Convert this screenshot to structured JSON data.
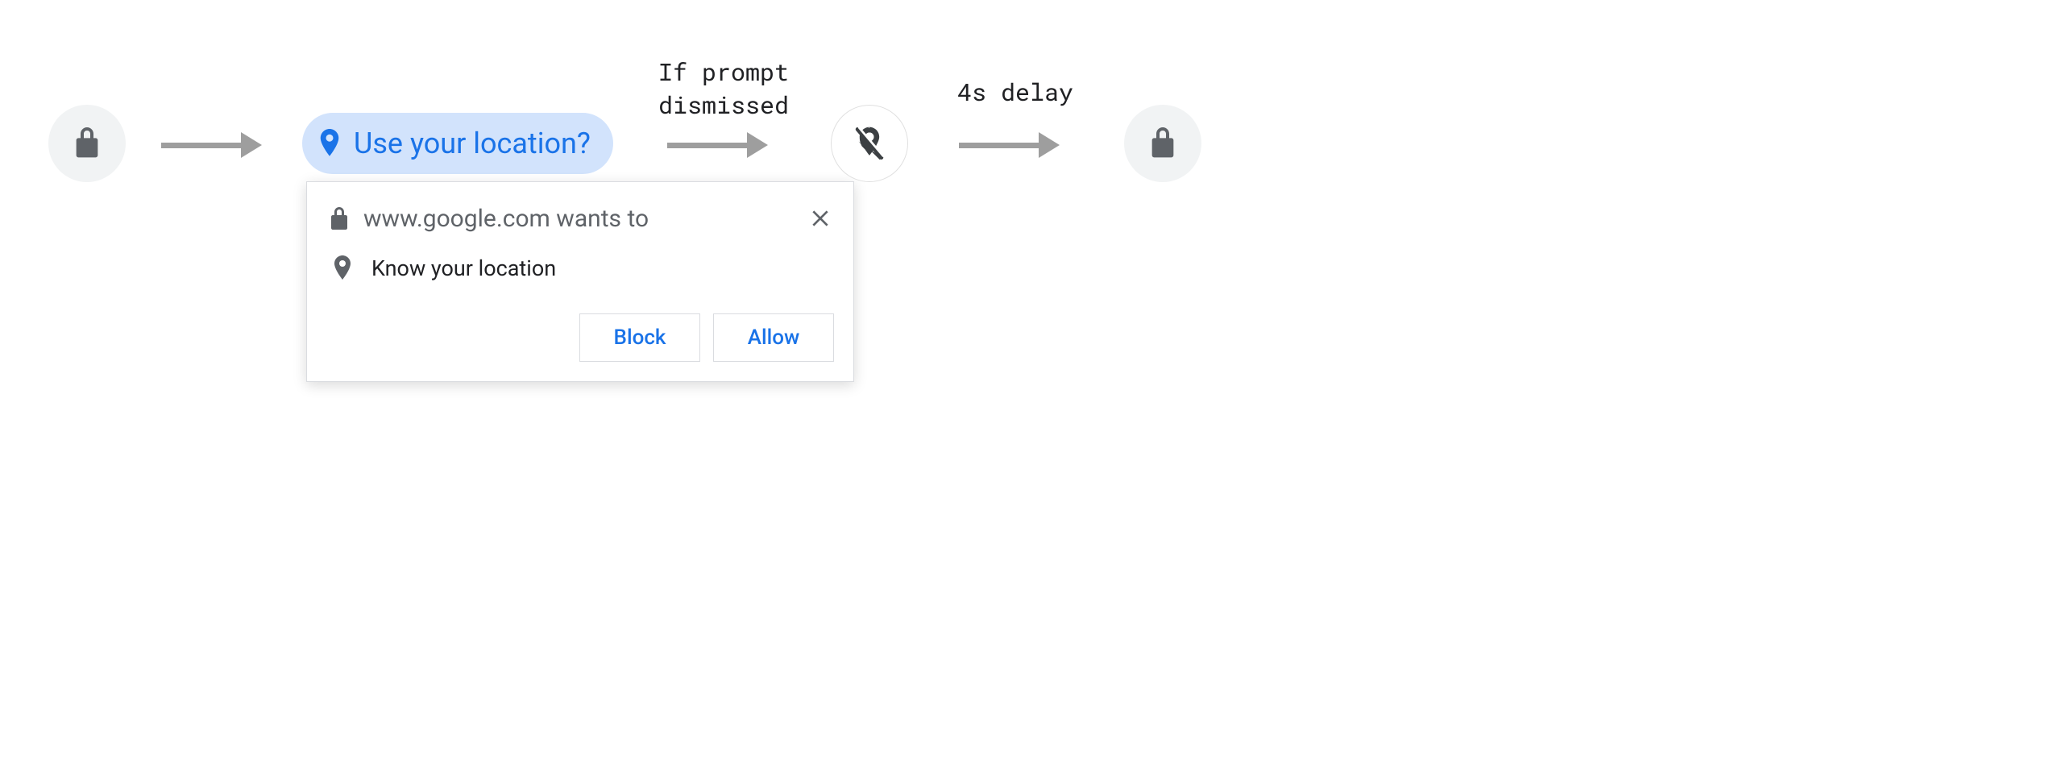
{
  "chip": {
    "label": "Use your location?"
  },
  "dialog": {
    "title": "www.google.com wants to",
    "permission_row": "Know your location",
    "block_label": "Block",
    "allow_label": "Allow"
  },
  "captions": {
    "dismissed": "If prompt\ndismissed",
    "delay": "4s delay"
  }
}
